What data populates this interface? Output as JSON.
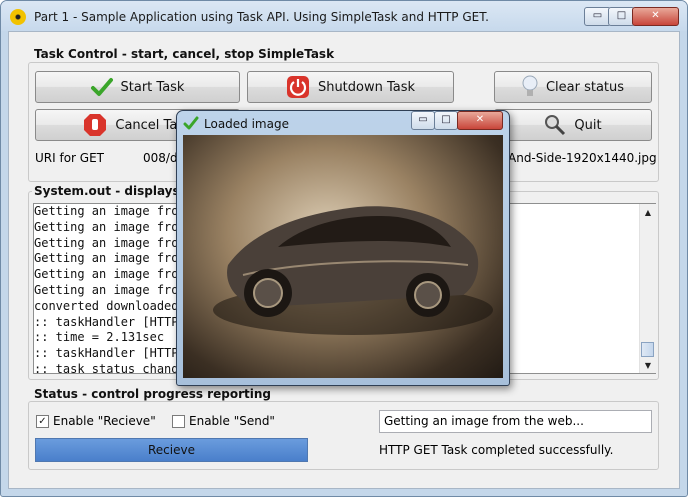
{
  "window": {
    "title": "Part 1 - Sample Application using Task API. Using SimpleTask and HTTP GET.",
    "minimize_glyph": "▭",
    "maximize_glyph": "□",
    "close_glyph": "✕"
  },
  "task_control": {
    "group_label": "Task Control - start, cancel, stop SimpleTask",
    "start_button": "Start Task",
    "shutdown_button": "Shutdown Task",
    "clear_button": "Clear status",
    "cancel_button": "Cancel Task",
    "quit_button": "Quit",
    "uri_label": "URI for GET",
    "uri_value_left": "008/d",
    "uri_value_right": "And-Side-1920x1440.jpg"
  },
  "system_out": {
    "group_label": "System.out - displays all st",
    "lines": [
      "Getting an image fro",
      "Getting an image fro",
      "Getting an image fro",
      "Getting an image fro",
      "Getting an image fro",
      "Getting an image fro",
      "converted downloaded",
      ":: taskHandler [HTTP",
      ":: time = 2.131sec",
      ":: taskHandler [HTTP",
      ":: task status chang"
    ]
  },
  "status": {
    "group_label": "Status - control progress reporting",
    "enable_receive_label": "Enable \"Recieve\"",
    "enable_receive_checked": true,
    "enable_send_label": "Enable \"Send\"",
    "enable_send_checked": false,
    "progress_label": "Recieve",
    "progress_fraction": 1.0,
    "status_field_value": "Getting an image from the web...",
    "status_message": "HTTP GET Task completed successfully."
  },
  "popup": {
    "title": "Loaded image",
    "close_glyph": "✕"
  },
  "colors": {
    "title_bar": "#c7d9ec",
    "progress_fill": "#4a7fcb",
    "check_green": "#3aa52a",
    "power_red": "#d9342b"
  },
  "icons": {
    "app": "radiation-icon",
    "start": "checkmark-icon",
    "shutdown": "power-icon",
    "clear": "lightbulb-icon",
    "cancel": "stop-hand-icon",
    "quit": "magnifier-icon",
    "popup": "checkmark-icon"
  }
}
